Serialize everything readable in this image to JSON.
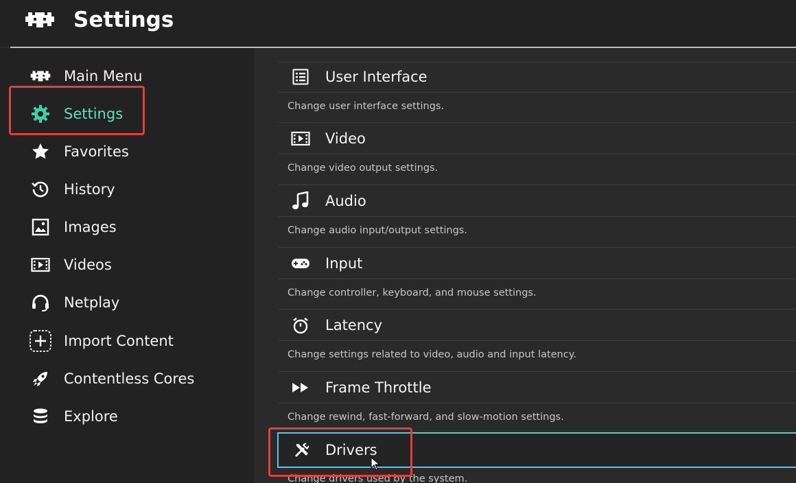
{
  "header": {
    "title": "Settings",
    "logo_icon": "retroarch-invader-icon"
  },
  "sidebar": {
    "items": [
      {
        "label": "Main Menu",
        "icon": "invader-icon"
      },
      {
        "label": "Settings",
        "icon": "gear-icon",
        "active": true
      },
      {
        "label": "Favorites",
        "icon": "star-icon"
      },
      {
        "label": "History",
        "icon": "history-icon"
      },
      {
        "label": "Images",
        "icon": "image-icon"
      },
      {
        "label": "Videos",
        "icon": "film-icon"
      },
      {
        "label": "Netplay",
        "icon": "headset-icon"
      },
      {
        "label": "Import Content",
        "icon": "plus-icon"
      },
      {
        "label": "Contentless Cores",
        "icon": "rocket-icon"
      },
      {
        "label": "Explore",
        "icon": "database-icon"
      }
    ]
  },
  "settings": {
    "entries": [
      {
        "label": "User Interface",
        "description": "Change user interface settings.",
        "icon": "list-icon"
      },
      {
        "label": "Video",
        "description": "Change video output settings.",
        "icon": "film-icon"
      },
      {
        "label": "Audio",
        "description": "Change audio input/output settings.",
        "icon": "music-note-icon"
      },
      {
        "label": "Input",
        "description": "Change controller, keyboard, and mouse settings.",
        "icon": "gamepad-icon"
      },
      {
        "label": "Latency",
        "description": "Change settings related to video, audio and input latency.",
        "icon": "stopwatch-icon"
      },
      {
        "label": "Frame Throttle",
        "description": "Change rewind, fast-forward, and slow-motion settings.",
        "icon": "fast-forward-icon"
      },
      {
        "label": "Drivers",
        "description": "Change drivers used by the system.",
        "icon": "tools-icon",
        "selected": true
      }
    ]
  },
  "colors": {
    "accent": "#5ee0ba",
    "selection_border": "#62c6d8",
    "annotation": "#e63d3d"
  }
}
